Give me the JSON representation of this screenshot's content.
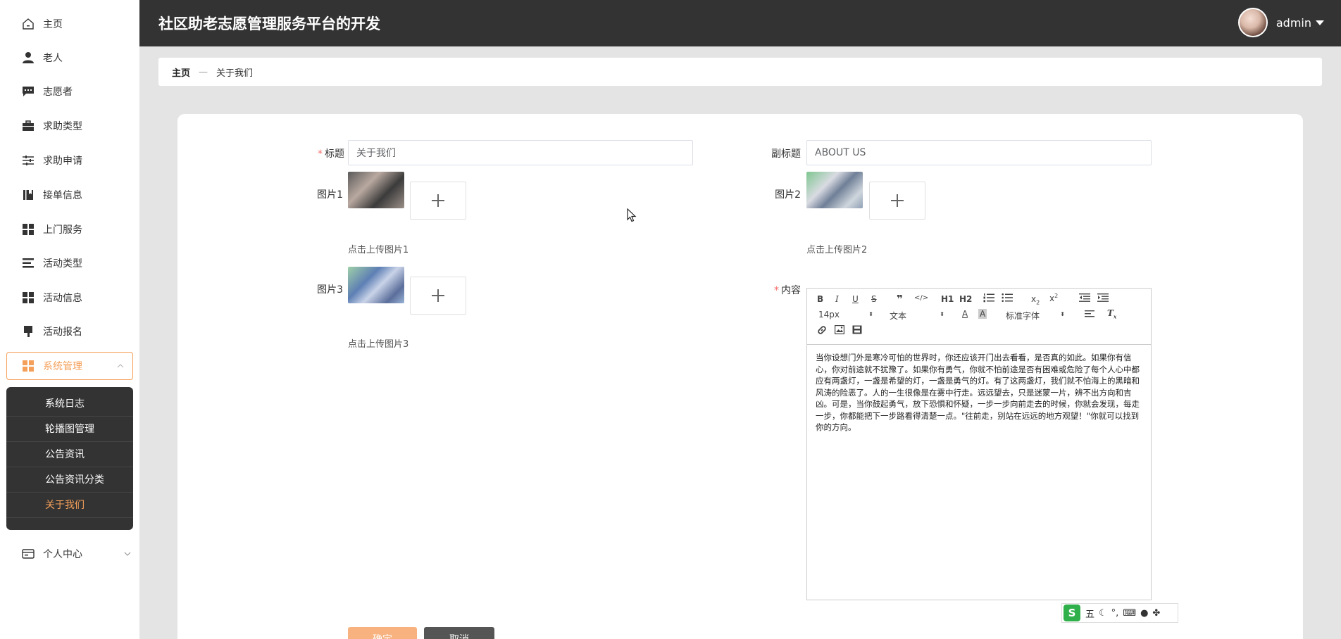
{
  "app": {
    "title": "社区助老志愿管理服务平台的开发"
  },
  "user": {
    "name": "admin"
  },
  "sidebar": {
    "items": [
      {
        "label": "主页",
        "icon": "home-icon"
      },
      {
        "label": "老人",
        "icon": "person-icon"
      },
      {
        "label": "志愿者",
        "icon": "chat-icon"
      },
      {
        "label": "求助类型",
        "icon": "briefcase-icon"
      },
      {
        "label": "求助申请",
        "icon": "sliders-icon"
      },
      {
        "label": "接单信息",
        "icon": "book-icon"
      },
      {
        "label": "上门服务",
        "icon": "grid-icon"
      },
      {
        "label": "活动类型",
        "icon": "list-icon"
      },
      {
        "label": "活动信息",
        "icon": "grid-icon"
      },
      {
        "label": "活动报名",
        "icon": "brush-icon"
      },
      {
        "label": "系统管理",
        "icon": "grid-icon"
      },
      {
        "label": "个人中心",
        "icon": "wallet-icon"
      }
    ],
    "submenu": [
      "系统日志",
      "轮播图管理",
      "公告资讯",
      "公告资讯分类",
      "关于我们"
    ]
  },
  "breadcrumb": {
    "home": "主页",
    "separator": "—",
    "current": "关于我们"
  },
  "form": {
    "title_label": "标题",
    "title_value": "关于我们",
    "subtitle_label": "副标题",
    "subtitle_value": "ABOUT US",
    "pic1_label": "图片1",
    "pic1_hint": "点击上传图片1",
    "pic2_label": "图片2",
    "pic2_hint": "点击上传图片2",
    "pic3_label": "图片3",
    "pic3_hint": "点击上传图片3",
    "content_label": "内容",
    "content_text": "当你设想门外是寒冷可怕的世界时，你还应该开门出去看看，是否真的如此。如果你有信心，你对前途就不犹豫了。如果你有勇气，你就不怕前途是否有困难或危险了每个人心中都应有两盏灯，一盏是希望的灯，一盏是勇气的灯。有了这两盏灯，我们就不怕海上的黑暗和风涛的险恶了。人的一生很像是在雾中行走。远远望去，只是迷蒙一片，辨不出方向和吉凶。可是，当你鼓起勇气，放下恐惧和怀疑，一步一步向前走去的时候，你就会发现，每走一步，你都能把下一步路看得清楚一点。\"往前走，别站在远远的地方观望！\"你就可以找到你的方向。",
    "confirm_label": "确定",
    "cancel_label": "取消"
  },
  "editor_toolbar": {
    "font_size": "14px",
    "text_type": "文本",
    "font_family": "标准字体",
    "h1": "H1",
    "h2": "H2"
  },
  "ime": {
    "mode": "五"
  },
  "colors": {
    "accent": "#f5a05a",
    "header_bg": "#333333",
    "required": "#f56c6c"
  }
}
